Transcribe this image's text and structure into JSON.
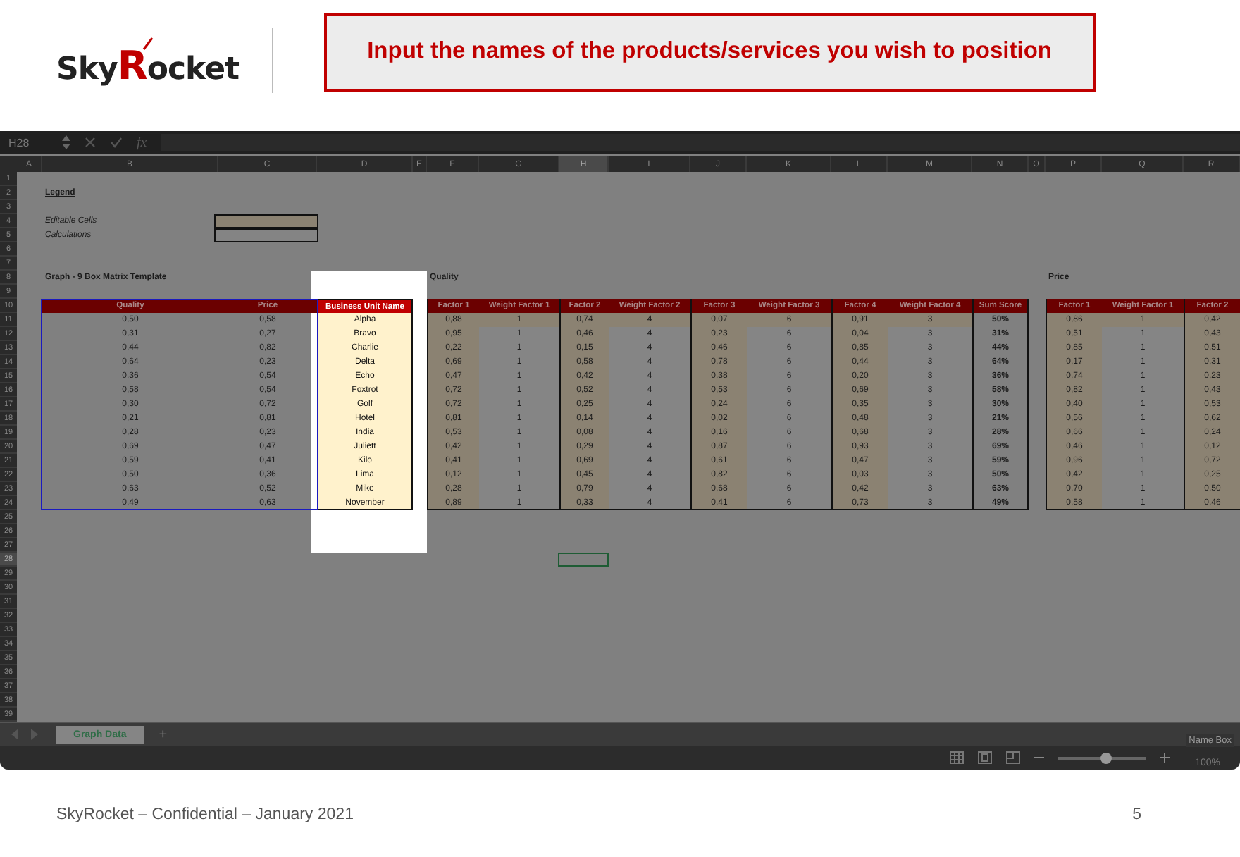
{
  "logo": [
    {
      "text": "Sky",
      "kind": "plain"
    },
    {
      "text": "R",
      "kind": "accent"
    },
    {
      "text": "ocket",
      "kind": "plain"
    }
  ],
  "callout": "Input the names of the products/services you wish to position",
  "formula_bar": {
    "cell_ref": "H28",
    "fx": "fx"
  },
  "columns": [
    {
      "label": "A",
      "selected": false
    },
    {
      "label": "B",
      "selected": false
    },
    {
      "label": "C",
      "selected": false
    },
    {
      "label": "D",
      "selected": false
    },
    {
      "label": "E",
      "selected": false
    },
    {
      "label": "F",
      "selected": false
    },
    {
      "label": "G",
      "selected": false
    },
    {
      "label": "H",
      "selected": true
    },
    {
      "label": "I",
      "selected": false
    },
    {
      "label": "J",
      "selected": false
    },
    {
      "label": "K",
      "selected": false
    },
    {
      "label": "L",
      "selected": false
    },
    {
      "label": "M",
      "selected": false
    },
    {
      "label": "N",
      "selected": false
    },
    {
      "label": "O",
      "selected": false
    },
    {
      "label": "P",
      "selected": false
    },
    {
      "label": "Q",
      "selected": false
    },
    {
      "label": "R",
      "selected": false
    }
  ],
  "rows": [
    {
      "label": "1",
      "selected": false
    },
    {
      "label": "2",
      "selected": false
    },
    {
      "label": "3",
      "selected": false
    },
    {
      "label": "4",
      "selected": false
    },
    {
      "label": "5",
      "selected": false
    },
    {
      "label": "6",
      "selected": false
    },
    {
      "label": "7",
      "selected": false
    },
    {
      "label": "8",
      "selected": false
    },
    {
      "label": "9",
      "selected": false
    },
    {
      "label": "10",
      "selected": false
    },
    {
      "label": "11",
      "selected": false
    },
    {
      "label": "12",
      "selected": false
    },
    {
      "label": "13",
      "selected": false
    },
    {
      "label": "14",
      "selected": false
    },
    {
      "label": "15",
      "selected": false
    },
    {
      "label": "16",
      "selected": false
    },
    {
      "label": "17",
      "selected": false
    },
    {
      "label": "18",
      "selected": false
    },
    {
      "label": "19",
      "selected": false
    },
    {
      "label": "20",
      "selected": false
    },
    {
      "label": "21",
      "selected": false
    },
    {
      "label": "22",
      "selected": false
    },
    {
      "label": "23",
      "selected": false
    },
    {
      "label": "24",
      "selected": false
    },
    {
      "label": "25",
      "selected": false
    },
    {
      "label": "26",
      "selected": false
    },
    {
      "label": "27",
      "selected": false
    },
    {
      "label": "28",
      "selected": true
    },
    {
      "label": "29",
      "selected": false
    },
    {
      "label": "30",
      "selected": false
    },
    {
      "label": "31",
      "selected": false
    },
    {
      "label": "32",
      "selected": false
    },
    {
      "label": "33",
      "selected": false
    },
    {
      "label": "34",
      "selected": false
    },
    {
      "label": "35",
      "selected": false
    },
    {
      "label": "36",
      "selected": false
    },
    {
      "label": "37",
      "selected": false
    },
    {
      "label": "38",
      "selected": false
    },
    {
      "label": "39",
      "selected": false
    }
  ],
  "legend": {
    "title": "Legend",
    "items": [
      {
        "label": "Editable Cells",
        "kind": "editable"
      },
      {
        "label": "Calculations",
        "kind": "calculation"
      }
    ]
  },
  "graph_title": "Graph - 9 Box Matrix Template",
  "main_table": {
    "columns": [
      {
        "label": "Quality",
        "kind": "value"
      },
      {
        "label": "Price",
        "kind": "value"
      },
      {
        "label": "Business Unit Name",
        "kind": "name"
      }
    ],
    "rows": [
      [
        "0,50",
        "0,58",
        "Alpha"
      ],
      [
        "0,31",
        "0,27",
        "Bravo"
      ],
      [
        "0,44",
        "0,82",
        "Charlie"
      ],
      [
        "0,64",
        "0,23",
        "Delta"
      ],
      [
        "0,36",
        "0,54",
        "Echo"
      ],
      [
        "0,58",
        "0,54",
        "Foxtrot"
      ],
      [
        "0,30",
        "0,72",
        "Golf"
      ],
      [
        "0,21",
        "0,81",
        "Hotel"
      ],
      [
        "0,28",
        "0,23",
        "India"
      ],
      [
        "0,69",
        "0,47",
        "Juliett"
      ],
      [
        "0,59",
        "0,41",
        "Kilo"
      ],
      [
        "0,50",
        "0,36",
        "Lima"
      ],
      [
        "0,63",
        "0,52",
        "Mike"
      ],
      [
        "0,49",
        "0,63",
        "November"
      ]
    ]
  },
  "quality": {
    "title": "Quality",
    "columns": [
      {
        "label": "Factor 1",
        "kind": "factor"
      },
      {
        "label": "Weight Factor 1",
        "kind": "weight"
      },
      {
        "label": "Factor 2",
        "kind": "factor"
      },
      {
        "label": "Weight Factor 2",
        "kind": "weight"
      },
      {
        "label": "Factor 3",
        "kind": "factor"
      },
      {
        "label": "Weight Factor 3",
        "kind": "weight"
      },
      {
        "label": "Factor 4",
        "kind": "factor"
      },
      {
        "label": "Weight Factor 4",
        "kind": "weight"
      },
      {
        "label": "Sum Score",
        "kind": "score"
      }
    ],
    "rows": [
      [
        "0,88",
        "1",
        "0,74",
        "4",
        "0,07",
        "6",
        "0,91",
        "3",
        "50%"
      ],
      [
        "0,95",
        "1",
        "0,46",
        "4",
        "0,23",
        "6",
        "0,04",
        "3",
        "31%"
      ],
      [
        "0,22",
        "1",
        "0,15",
        "4",
        "0,46",
        "6",
        "0,85",
        "3",
        "44%"
      ],
      [
        "0,69",
        "1",
        "0,58",
        "4",
        "0,78",
        "6",
        "0,44",
        "3",
        "64%"
      ],
      [
        "0,47",
        "1",
        "0,42",
        "4",
        "0,38",
        "6",
        "0,20",
        "3",
        "36%"
      ],
      [
        "0,72",
        "1",
        "0,52",
        "4",
        "0,53",
        "6",
        "0,69",
        "3",
        "58%"
      ],
      [
        "0,72",
        "1",
        "0,25",
        "4",
        "0,24",
        "6",
        "0,35",
        "3",
        "30%"
      ],
      [
        "0,81",
        "1",
        "0,14",
        "4",
        "0,02",
        "6",
        "0,48",
        "3",
        "21%"
      ],
      [
        "0,53",
        "1",
        "0,08",
        "4",
        "0,16",
        "6",
        "0,68",
        "3",
        "28%"
      ],
      [
        "0,42",
        "1",
        "0,29",
        "4",
        "0,87",
        "6",
        "0,93",
        "3",
        "69%"
      ],
      [
        "0,41",
        "1",
        "0,69",
        "4",
        "0,61",
        "6",
        "0,47",
        "3",
        "59%"
      ],
      [
        "0,12",
        "1",
        "0,45",
        "4",
        "0,82",
        "6",
        "0,03",
        "3",
        "50%"
      ],
      [
        "0,28",
        "1",
        "0,79",
        "4",
        "0,68",
        "6",
        "0,42",
        "3",
        "63%"
      ],
      [
        "0,89",
        "1",
        "0,33",
        "4",
        "0,41",
        "6",
        "0,73",
        "3",
        "49%"
      ]
    ]
  },
  "price": {
    "title": "Price",
    "columns": [
      {
        "label": "Factor 1",
        "kind": "factor"
      },
      {
        "label": "Weight Factor 1",
        "kind": "weight"
      },
      {
        "label": "Factor 2",
        "kind": "factor"
      }
    ],
    "rows": [
      [
        "0,86",
        "1",
        "0,42"
      ],
      [
        "0,51",
        "1",
        "0,43"
      ],
      [
        "0,85",
        "1",
        "0,51"
      ],
      [
        "0,17",
        "1",
        "0,31"
      ],
      [
        "0,74",
        "1",
        "0,23"
      ],
      [
        "0,82",
        "1",
        "0,43"
      ],
      [
        "0,40",
        "1",
        "0,53"
      ],
      [
        "0,56",
        "1",
        "0,62"
      ],
      [
        "0,66",
        "1",
        "0,24"
      ],
      [
        "0,46",
        "1",
        "0,12"
      ],
      [
        "0,96",
        "1",
        "0,72"
      ],
      [
        "0,42",
        "1",
        "0,25"
      ],
      [
        "0,70",
        "1",
        "0,50"
      ],
      [
        "0,58",
        "1",
        "0,46"
      ]
    ]
  },
  "sheet_tabs": [
    {
      "label": "Graph Data",
      "selected": true
    }
  ],
  "add_sheet": "+",
  "status": {
    "tooltip": "Name Box",
    "zoom": "100%",
    "zoom_slider": {
      "level": 0.55
    }
  },
  "footer": {
    "text": "SkyRocket – Confidential – January 2021",
    "page": "5"
  }
}
